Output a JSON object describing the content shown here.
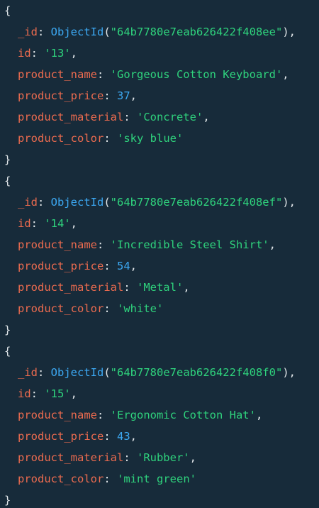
{
  "colors": {
    "background": "#172b3a",
    "key": "#ec6b4f",
    "string": "#2fd37d",
    "number": "#3ca8f2",
    "function": "#3ca8f2",
    "punctuation": "#e3e8eb"
  },
  "documents": [
    {
      "open_brace": "{",
      "close_brace": "}",
      "oid_key": "_id",
      "oid_fn": "ObjectId",
      "oid_value": "\"64b7780e7eab626422f408ee\"",
      "id_key": "id",
      "id_value": "'13'",
      "name_key": "product_name",
      "name_value": "'Gorgeous Cotton Keyboard'",
      "price_key": "product_price",
      "price_value": "37",
      "material_key": "product_material",
      "material_value": "'Concrete'",
      "color_key": "product_color",
      "color_value": "'sky blue'"
    },
    {
      "open_brace": "{",
      "close_brace": "}",
      "oid_key": "_id",
      "oid_fn": "ObjectId",
      "oid_value": "\"64b7780e7eab626422f408ef\"",
      "id_key": "id",
      "id_value": "'14'",
      "name_key": "product_name",
      "name_value": "'Incredible Steel Shirt'",
      "price_key": "product_price",
      "price_value": "54",
      "material_key": "product_material",
      "material_value": "'Metal'",
      "color_key": "product_color",
      "color_value": "'white'"
    },
    {
      "open_brace": "{",
      "close_brace": "}",
      "oid_key": "_id",
      "oid_fn": "ObjectId",
      "oid_value": "\"64b7780e7eab626422f408f0\"",
      "id_key": "id",
      "id_value": "'15'",
      "name_key": "product_name",
      "name_value": "'Ergonomic Cotton Hat'",
      "price_key": "product_price",
      "price_value": "43",
      "material_key": "product_material",
      "material_value": "'Rubber'",
      "color_key": "product_color",
      "color_value": "'mint green'"
    }
  ]
}
